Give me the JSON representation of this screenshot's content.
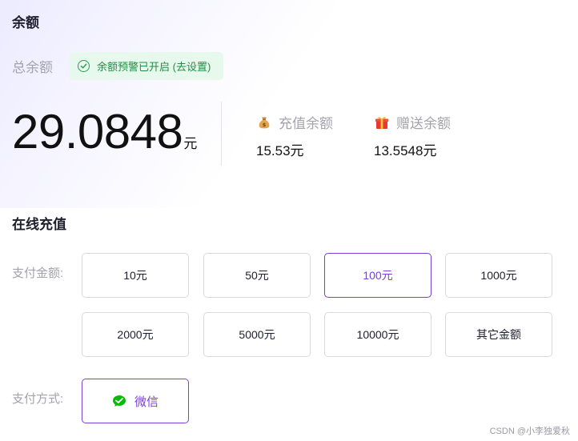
{
  "balance": {
    "title": "余额",
    "total_label": "总余额",
    "alert_text": "余额预警已开启 (去设置)",
    "total_amount": "29.0848",
    "unit": "元",
    "recharge_label": "充值余额",
    "recharge_value": "15.53元",
    "gift_label": "赠送余额",
    "gift_value": "13.5548元"
  },
  "recharge": {
    "title": "在线充值",
    "amount_label": "支付金额:",
    "options": [
      "10元",
      "50元",
      "100元",
      "1000元",
      "2000元",
      "5000元",
      "10000元",
      "其它金额"
    ],
    "selected_option": "100元",
    "method_label": "支付方式:",
    "method": "微信"
  },
  "colors": {
    "accent": "#7a3fd6",
    "alert_bg": "#e6f9ec",
    "alert_text": "#1f8f45",
    "wechat": "#09bb07"
  },
  "watermark": "CSDN @小李独爱秋"
}
